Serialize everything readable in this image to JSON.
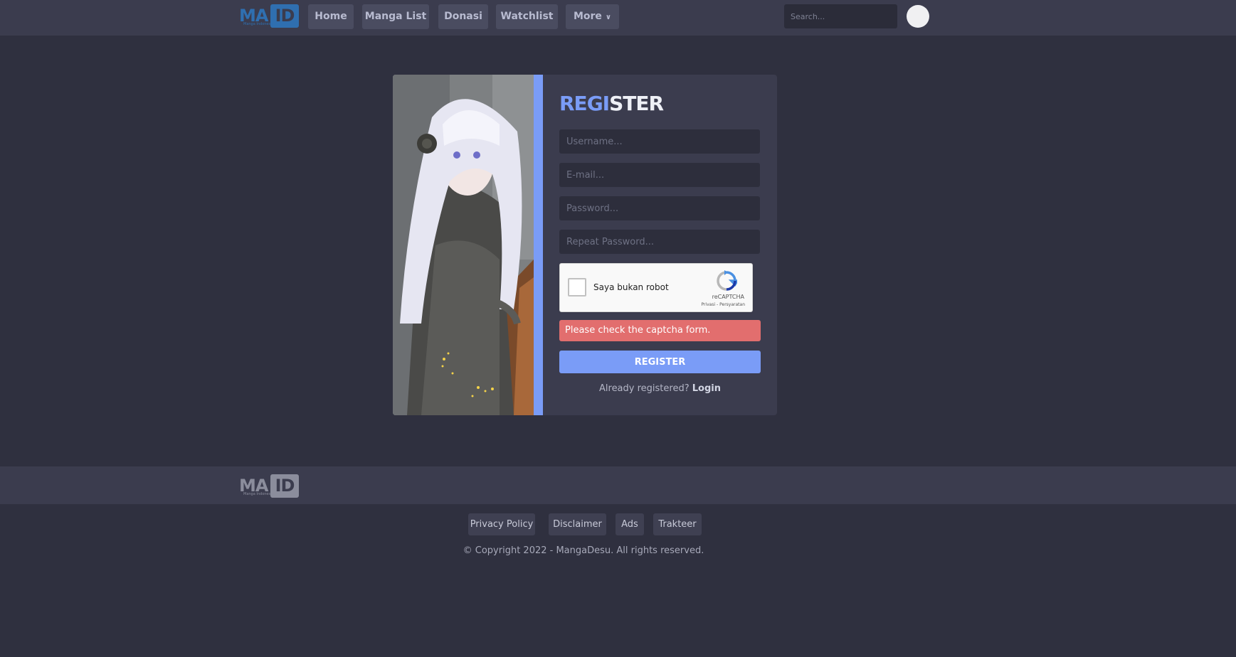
{
  "header": {
    "logo": {
      "main": "MA",
      "box": "ID",
      "sub": "Manga Indonesia"
    },
    "nav": [
      "Home",
      "Manga List",
      "Donasi",
      "Watchlist",
      "More"
    ],
    "search_placeholder": "Search..."
  },
  "register": {
    "title_highlight": "REGI",
    "title_rest": "STER",
    "username_placeholder": "Username...",
    "email_placeholder": "E-mail...",
    "password_placeholder": "Password...",
    "repeat_password_placeholder": "Repeat Password...",
    "captcha": {
      "label": "Saya bukan robot",
      "brand": "reCAPTCHA",
      "links": "Privasi - Persyaratan"
    },
    "error": "Please check the captcha form.",
    "submit": "REGISTER",
    "already_text": "Already registered?",
    "login_link": "Login"
  },
  "footer": {
    "logo": {
      "main": "MA",
      "box": "ID",
      "sub": "Manga Indonesia"
    },
    "links": [
      "Privacy Policy",
      "Disclaimer",
      "Ads",
      "Trakteer"
    ],
    "copyright": "© Copyright 2022 - MangaDesu. All rights reserved."
  },
  "colors": {
    "background": "#2f303f",
    "bar": "#3b3c4e",
    "accent": "#7a9cf7",
    "error": "#e26e6e",
    "logo_blue": "#2f6fb0"
  },
  "icons": [
    "chevron-down-icon",
    "recaptcha-icon"
  ]
}
